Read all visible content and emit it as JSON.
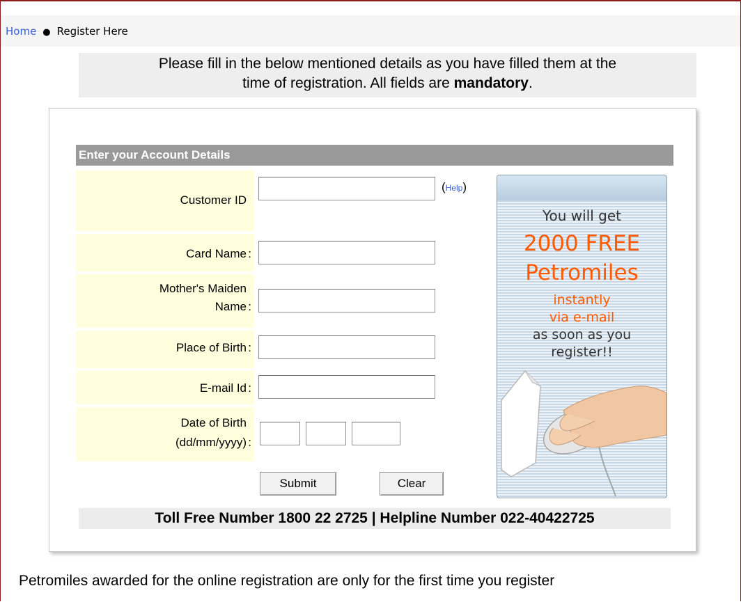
{
  "breadcrumb": {
    "home": "Home",
    "current": "Register Here"
  },
  "intro": {
    "line1": "Please fill in the below mentioned details as you have filled them at the",
    "line2_prefix": "time of registration. All fields are ",
    "line2_bold": "mandatory",
    "line2_suffix": "."
  },
  "form": {
    "header": "Enter your Account Details",
    "customer_id_label": "Customer ID",
    "help_open": "(",
    "help_link": "Help",
    "help_close": ")",
    "card_name_label": "Card Name",
    "maiden_label_1": "Mother's Maiden",
    "maiden_label_2": "Name",
    "birth_place_label": "Place of Birth",
    "email_label": "E-mail Id",
    "dob_label_1": "Date of Birth",
    "dob_label_2": "(dd/mm/yyyy)",
    "colon": ":",
    "customer_id_value": "",
    "card_name_value": "",
    "maiden_value": "",
    "birth_place_value": "",
    "email_value": "",
    "dob_dd": "",
    "dob_mm": "",
    "dob_yyyy": "",
    "submit": "Submit",
    "clear": "Clear"
  },
  "promo": {
    "line1": "You will get",
    "line2": "2000 FREE",
    "line3": "Petromiles",
    "line4": "instantly",
    "line5": "via e-mail",
    "line6": "as soon as you",
    "line7": "register!!",
    "accent": "#ff5a00"
  },
  "contact": "Toll Free Number 1800 22 2725 | Helpline Number 022-40422725",
  "footer": "Petromiles awarded for the online registration are only for the first time you register",
  "colors": {
    "header_bg": "#999999",
    "label_bg": "#ffffdd",
    "link": "#3b5bdb"
  }
}
